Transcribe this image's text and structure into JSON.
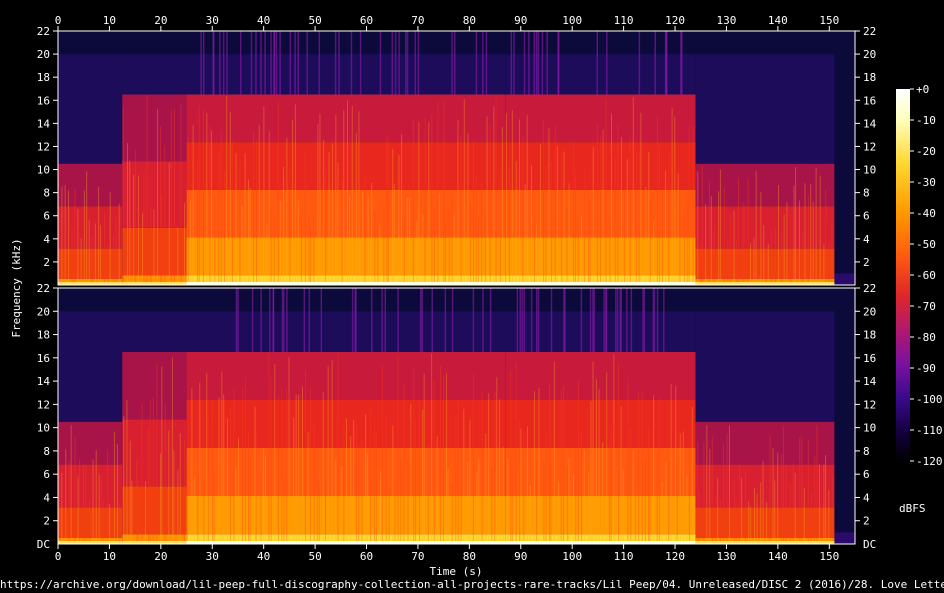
{
  "source_url": "https://archive.org/download/lil-peep-full-discography-collection-all-projects-rare-tracks/Lil Peep/04. Unreleased/DISC 2 (2016)/28. Love Letter.mp3",
  "chart_data": {
    "type": "heatmap",
    "subtype": "spectrogram",
    "channels": 2,
    "xlabel": "Time (s)",
    "ylabel": "Frequency (kHz)",
    "xlim": [
      0,
      155
    ],
    "ylim": [
      0,
      22
    ],
    "x_ticks": [
      0,
      10,
      20,
      30,
      40,
      50,
      60,
      70,
      80,
      90,
      100,
      110,
      120,
      130,
      140,
      150
    ],
    "y_ticks": [
      2,
      4,
      6,
      8,
      10,
      12,
      14,
      16,
      18,
      20,
      22
    ],
    "y_zero_label": "DC",
    "colorbar": {
      "label": "dBFS",
      "ticks": [
        "+0",
        "-10",
        "-20",
        "-30",
        "-40",
        "-50",
        "-60",
        "-70",
        "-80",
        "-90",
        "-100",
        "-110",
        "-120"
      ],
      "range": [
        -120,
        0
      ],
      "colors": [
        "#000000",
        "#140040",
        "#3a0a8c",
        "#7a10a0",
        "#b01870",
        "#e02828",
        "#ff5a10",
        "#ff9a00",
        "#ffd830",
        "#ffffc0",
        "#ffffff"
      ]
    },
    "segments": [
      {
        "start": 0,
        "end": 12.5,
        "top_khz": 10.5,
        "level": "medium"
      },
      {
        "start": 12.5,
        "end": 25,
        "top_khz": 16.5,
        "level": "medium"
      },
      {
        "start": 25,
        "end": 87,
        "top_khz": 16.5,
        "level": "high"
      },
      {
        "start": 87,
        "end": 124,
        "top_khz": 16.5,
        "level": "high"
      },
      {
        "start": 124,
        "end": 151,
        "top_khz": 10.5,
        "level": "medium"
      },
      {
        "start": 151,
        "end": 155,
        "top_khz": 1,
        "level": "silence"
      }
    ]
  }
}
